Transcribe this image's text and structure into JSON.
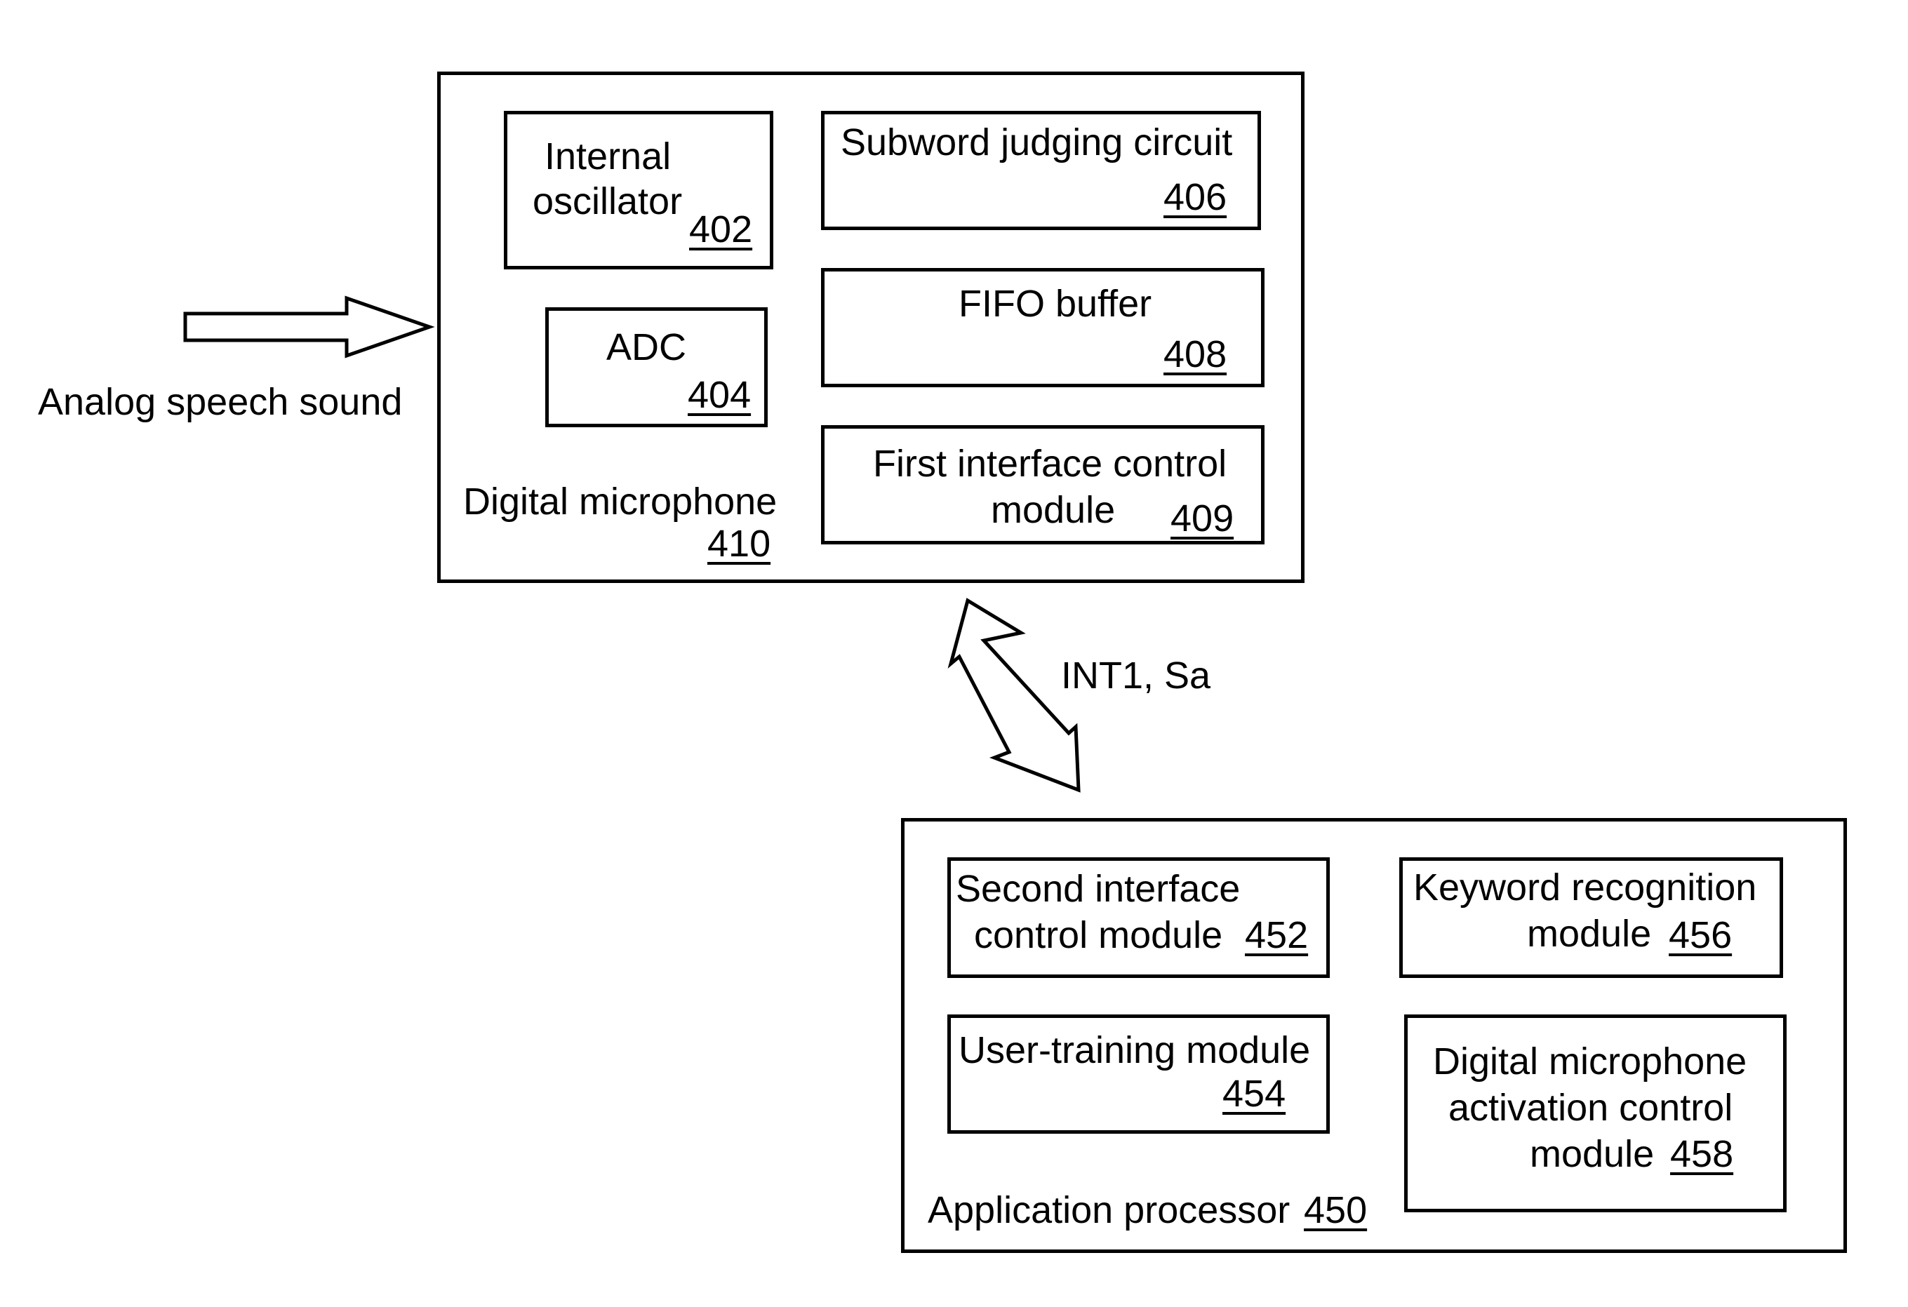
{
  "input": {
    "label": "Analog speech sound",
    "arrow_icon": "right-hollow-arrow"
  },
  "digital_microphone": {
    "label": "Digital microphone",
    "ref": "410",
    "blocks": {
      "internal_oscillator": {
        "line1": "Internal",
        "line2": "oscillator",
        "ref": "402"
      },
      "adc": {
        "label": "ADC",
        "ref": "404"
      },
      "subword_judging_circuit": {
        "label": "Subword judging circuit",
        "ref": "406"
      },
      "fifo_buffer": {
        "label": "FIFO buffer",
        "ref": "408"
      },
      "first_interface_control_module": {
        "line1": "First interface control",
        "line2": "module",
        "ref": "409"
      }
    }
  },
  "link": {
    "label": "INT1, Sa",
    "arrow_icon": "bidirectional-hollow-arrow"
  },
  "application_processor": {
    "label": "Application processor",
    "ref": "450",
    "blocks": {
      "second_interface_control_module": {
        "line1": "Second interface",
        "line2": "control module",
        "ref": "452"
      },
      "user_training_module": {
        "label": "User-training module",
        "ref": "454"
      },
      "keyword_recognition_module": {
        "line1": "Keyword recognition",
        "line2": "module",
        "ref": "456"
      },
      "digital_microphone_activation_control_module": {
        "line1": "Digital microphone",
        "line2": "activation control",
        "line3": "module",
        "ref": "458"
      }
    }
  }
}
